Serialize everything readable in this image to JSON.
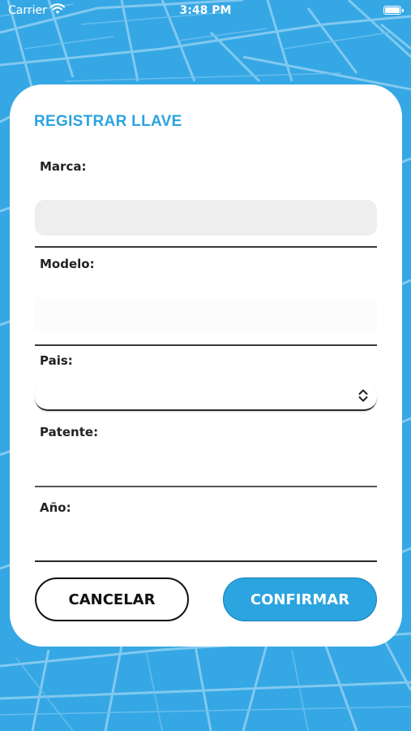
{
  "status_bar": {
    "carrier": "Carrier",
    "time": "3:48 PM",
    "wifi_icon": "wifi-icon",
    "battery_icon": "battery-icon"
  },
  "colors": {
    "background": "#35a7e4",
    "accent": "#2ba4df",
    "card": "#ffffff"
  },
  "form": {
    "title": "REGISTRAR LLAVE",
    "fields": {
      "marca": {
        "label": "Marca:",
        "value": ""
      },
      "modelo": {
        "label": "Modelo:",
        "value": ""
      },
      "pais": {
        "label": "Pais:",
        "selected": "",
        "icon": "chevron-up-down-icon"
      },
      "patente": {
        "label": "Patente:",
        "value": ""
      },
      "anio": {
        "label": "Año:",
        "value": ""
      }
    },
    "buttons": {
      "cancel_label": "CANCELAR",
      "confirm_label": "CONFIRMAR"
    }
  }
}
